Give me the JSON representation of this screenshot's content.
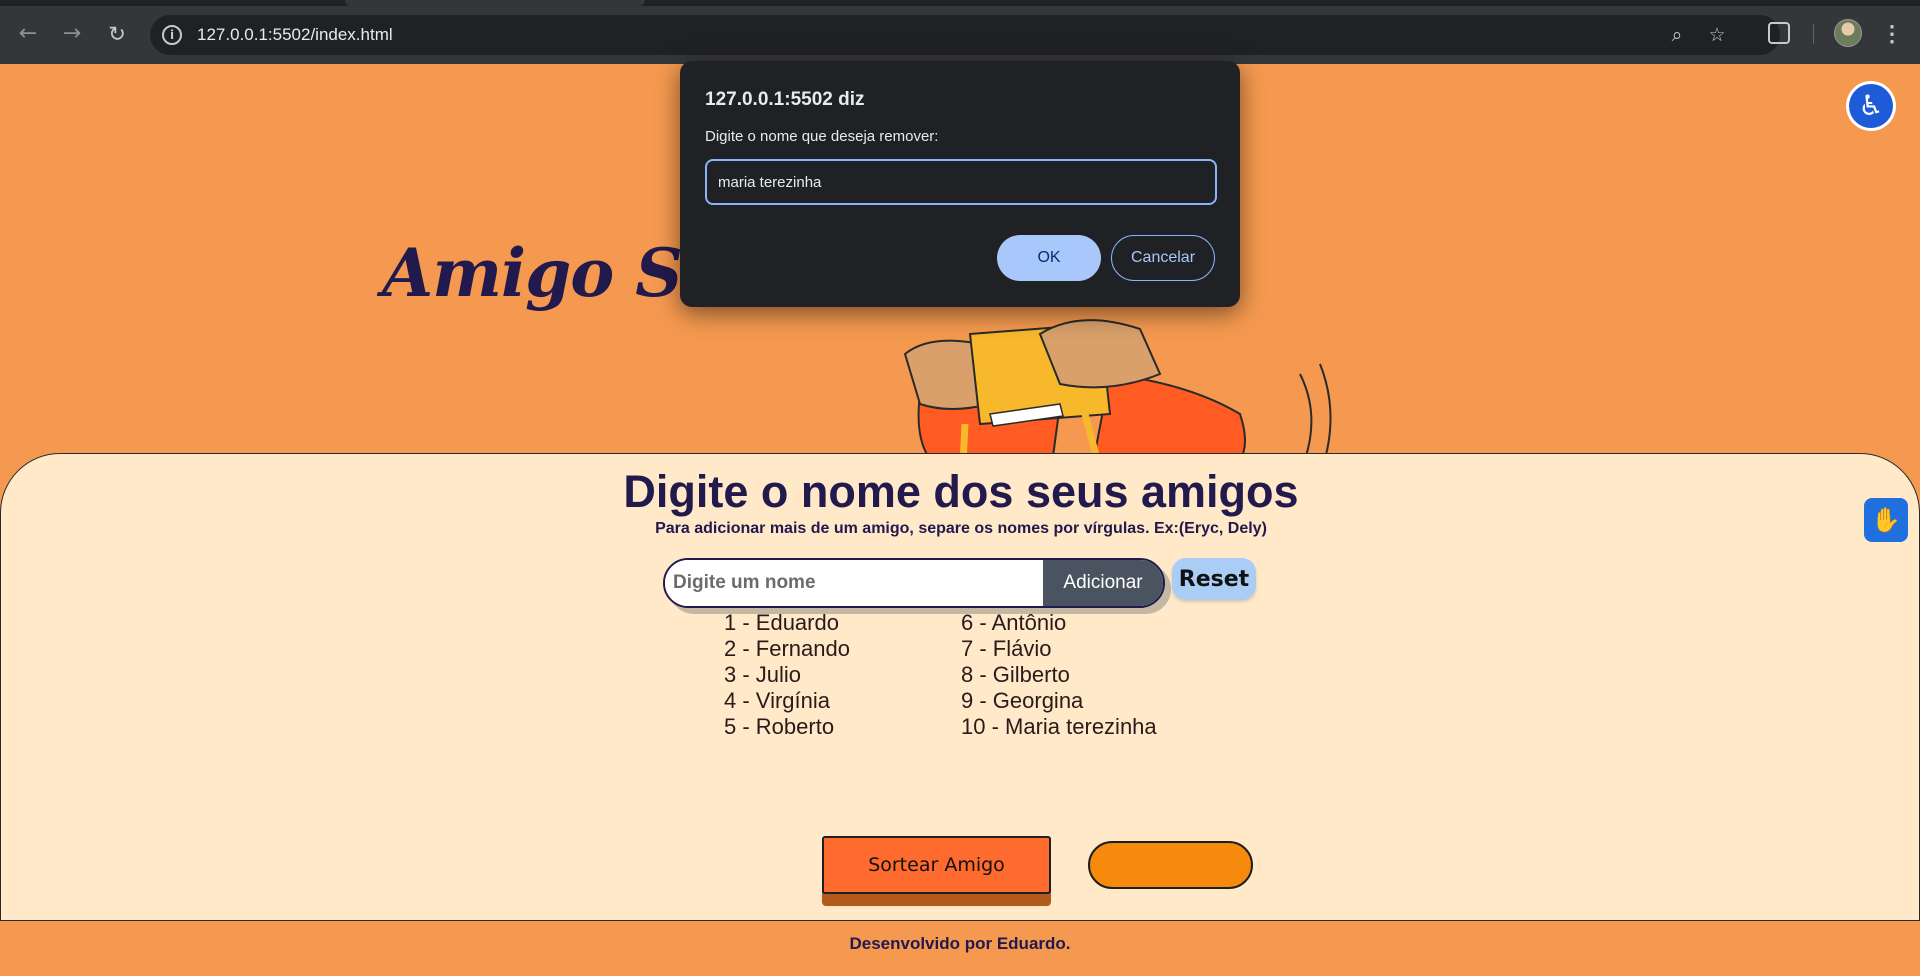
{
  "browser": {
    "url": "127.0.0.1:5502/index.html",
    "icons": [
      "back-arrow-icon",
      "forward-arrow-icon",
      "reload-icon",
      "site-info-icon",
      "zoom-icon",
      "bookmark-star-icon",
      "extensions-icon",
      "profile-avatar",
      "menu-kebab-icon"
    ]
  },
  "page": {
    "hero_title": "Amigo Sec",
    "card": {
      "title": "Digite o nome dos seus amigos",
      "subtitle": "Para adicionar mais de um amigo, separe os nomes por vírgulas. Ex:(Eryc, Dely)",
      "input_placeholder": "Digite um nome",
      "add_label": "Adicionar",
      "reset_label": "Reset",
      "friends_col1": [
        "1 - Eduardo",
        "2 - Fernando",
        "3 - Julio",
        "4 - Virgínia",
        "5 - Roberto"
      ],
      "friends_col2": [
        "6 - Antônio",
        "7 - Flávio",
        "8 - Gilberto",
        "9 - Georgina",
        "10 - Maria terezinha"
      ],
      "sortear_label": "Sortear Amigo"
    },
    "footer": "Desenvolvido por Eduardo."
  },
  "dialog": {
    "title": "127.0.0.1:5502 diz",
    "message": "Digite o nome que deseja remover:",
    "input_value": "maria terezinha",
    "ok_label": "OK",
    "cancel_label": "Cancelar"
  },
  "colors": {
    "background": "#f4994f",
    "card": "#ffe9c9",
    "title": "#22194d",
    "sortear": "#ff6a2e",
    "orange_button": "#f58a0c",
    "reset": "#a9cdf5",
    "accessibility": "#1d5bd8"
  }
}
